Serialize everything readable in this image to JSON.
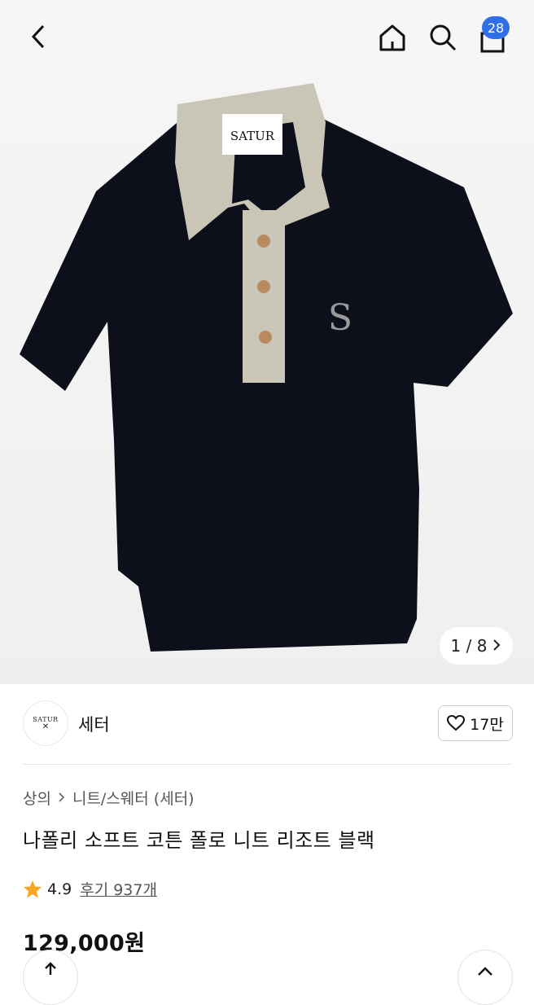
{
  "header": {
    "cart_count": "28",
    "back_icon": "chevron-left-icon",
    "home_icon": "home-icon",
    "search_icon": "search-icon",
    "cart_icon": "shopping-bag-icon"
  },
  "gallery": {
    "counter": "1 / 8",
    "product_label_text": "SATUR"
  },
  "brand": {
    "logo_text": "SATUR",
    "name": "세터",
    "likes": "17만"
  },
  "product": {
    "breadcrumb": [
      "상의",
      "니트/스웨터 (세터)"
    ],
    "title": "나폴리 소프트 코튼 폴로 니트 리조트 블랙",
    "rating": "4.9",
    "reviews": "후기 937개",
    "price": "129,000원"
  },
  "colors": {
    "badge": "#2f6fe8",
    "star": "#f5a623",
    "shirt": "#0d0f1a",
    "collar": "#c9c6b8"
  }
}
